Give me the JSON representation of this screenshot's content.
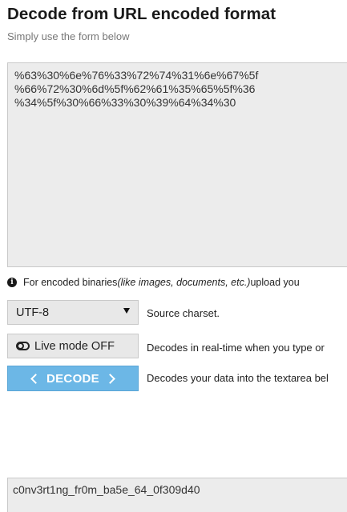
{
  "header": {
    "title": "Decode from URL encoded format",
    "subtitle": "Simply use the form below"
  },
  "input": {
    "value": "%63%30%6e%76%33%72%74%31%6e%67%5f\n%66%72%30%6d%5f%62%61%35%65%5f%36\n%34%5f%30%66%33%30%39%64%34%30"
  },
  "info": {
    "icon": "info-icon",
    "text_before": "For encoded binaries ",
    "text_italic": "(like images, documents, etc.)",
    "text_after": " upload you"
  },
  "controls": {
    "charset": {
      "selected": "UTF-8",
      "label": "Source charset."
    },
    "live_mode": {
      "button_label": "Live mode OFF",
      "label": "Decodes in real-time when you type or"
    },
    "decode": {
      "button_label": "DECODE",
      "label": "Decodes your data into the textarea bel",
      "color": "#6cb7e6"
    }
  },
  "output": {
    "value": "c0nv3rt1ng_fr0m_ba5e_64_0f309d40"
  }
}
